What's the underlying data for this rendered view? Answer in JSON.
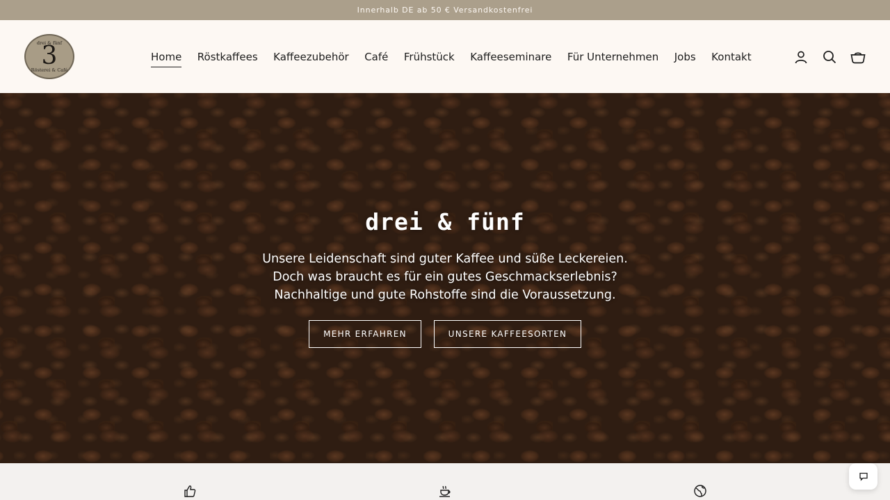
{
  "announcement": {
    "text": "Innerhalb DE ab 50 € Versandkostenfrei"
  },
  "logo": {
    "mark": "3",
    "top_text": "drei & fünf",
    "bottom_text": "Rösterei & Café"
  },
  "nav": {
    "items": [
      {
        "label": "Home",
        "active": true
      },
      {
        "label": "Röstkaffees"
      },
      {
        "label": "Kaffeezubehör"
      },
      {
        "label": "Café"
      },
      {
        "label": "Frühstück"
      },
      {
        "label": "Kaffeeseminare"
      },
      {
        "label": "Für Unternehmen"
      },
      {
        "label": "Jobs"
      },
      {
        "label": "Kontakt"
      }
    ]
  },
  "header_icons": [
    "account-icon",
    "search-icon",
    "cart-icon"
  ],
  "hero": {
    "title": "drei & fünf",
    "lines": [
      "Unsere Leidenschaft sind guter Kaffee und süße Leckereien.",
      "Doch was braucht es für ein gutes Geschmackserlebnis?",
      "Nachhaltige und gute Rohstoffe sind die Voraussetzung."
    ],
    "buttons": [
      {
        "label": "MEHR ERFAHREN"
      },
      {
        "label": "UNSERE KAFFEESORTEN"
      }
    ]
  },
  "features": {
    "icons": [
      "thumbs-up-icon",
      "coffee-cup-icon",
      "globe-icon"
    ]
  },
  "chat": {
    "icon": "chat-icon"
  },
  "colors": {
    "announcement_bg": "#ab9f8b",
    "header_bg": "#fdf8f3",
    "features_bg": "#f3f1ef",
    "text": "#1c1c1c"
  }
}
